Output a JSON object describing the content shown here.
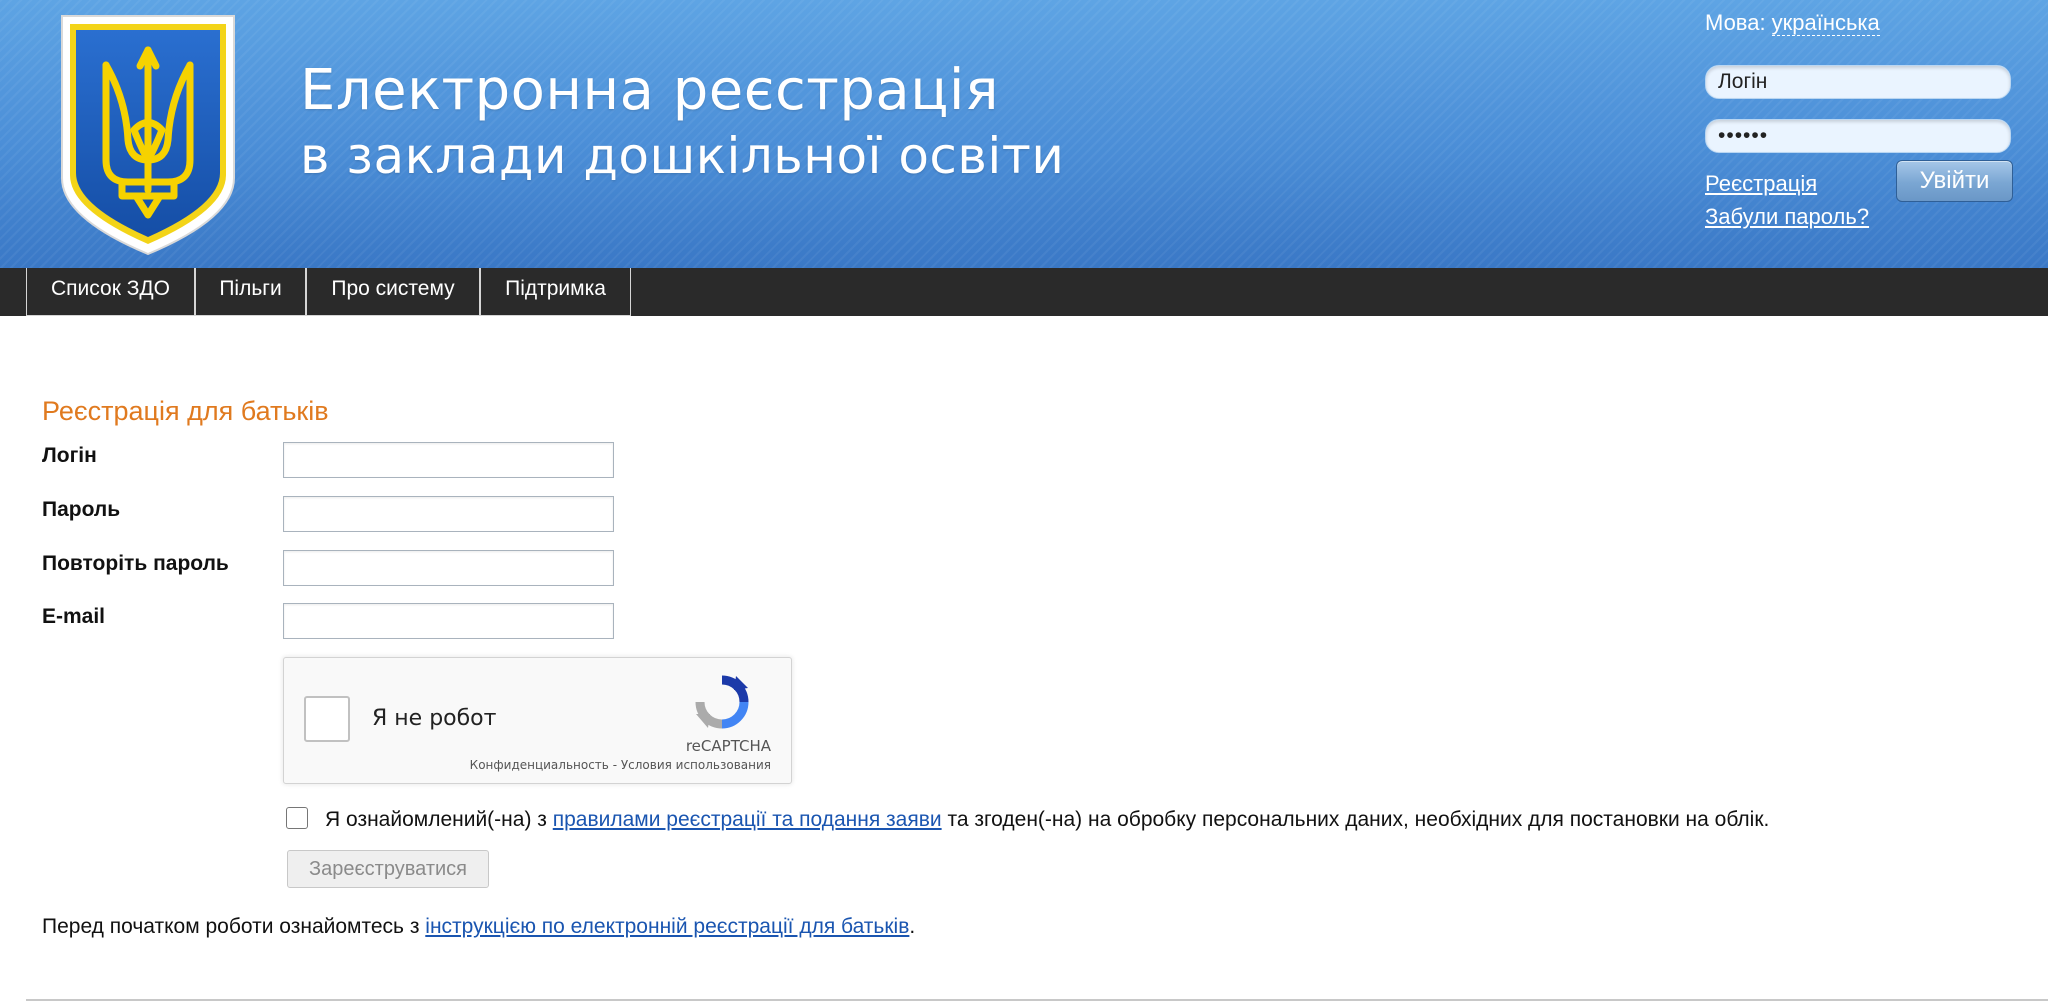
{
  "header": {
    "title_line1": "Електронна реєстрація",
    "title_line2": "в заклади дошкільної освіти",
    "language_label": "Мова:",
    "language_value": "українська",
    "login_value": "Логін",
    "password_value": "••••••",
    "register_link": "Реєстрація",
    "forgot_link": "Забули пароль?",
    "enter_button": "Увійти",
    "colors": {
      "banner": "#4b8ed7",
      "emblem_blue": "#1a5bb8",
      "emblem_yellow": "#f6d200"
    },
    "emblem_icon": "trident-coat-of-arms-icon"
  },
  "nav": {
    "items": [
      {
        "label": "Список ЗДО"
      },
      {
        "label": "Пільги"
      },
      {
        "label": "Про систему"
      },
      {
        "label": "Підтримка"
      }
    ]
  },
  "form": {
    "title": "Реєстрація для батьків",
    "fields": {
      "login": "Логін",
      "password": "Пароль",
      "repeat_password": "Повторіть пароль",
      "email": "E-mail"
    },
    "recaptcha": {
      "label": "Я не робот",
      "brand": "reCAPTCHA",
      "terms": "Конфиденциальность - Условия использования"
    },
    "agreement": {
      "prefix": "Я ознайомлений(-на) з ",
      "link": "правилами реєстрації та подання заяви",
      "suffix": " та згоден(-на) на обробку персональних даних, необхідних для постановки на облік."
    },
    "submit_label": "Зареєструватися"
  },
  "footer": {
    "prefix": "Перед початком роботи ознайомтесь з ",
    "link": "інструкцією по електронній реєстрації для батьків",
    "suffix": "."
  }
}
